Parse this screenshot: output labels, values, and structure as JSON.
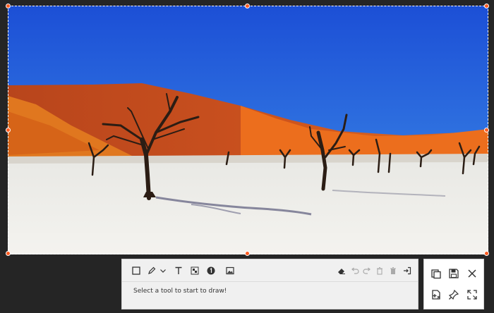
{
  "capture": {
    "image_description_icon": "desert-dead-trees-photo",
    "accent_color": "#ff5a1f"
  },
  "toolbar": {
    "tools": [
      {
        "name": "rectangle-tool",
        "icon": "square-icon"
      },
      {
        "name": "pen-tool",
        "icon": "pen-icon"
      },
      {
        "name": "pen-options-dropdown",
        "icon": "chevron-down-icon"
      },
      {
        "name": "text-tool",
        "icon": "text-icon"
      },
      {
        "name": "mosaic-tool",
        "icon": "mosaic-icon"
      },
      {
        "name": "step-number-tool",
        "icon": "numbered-circle-icon"
      },
      {
        "name": "image-tool",
        "icon": "image-icon"
      }
    ],
    "actions": [
      {
        "name": "eraser-button",
        "icon": "eraser-icon"
      },
      {
        "name": "undo-button",
        "icon": "undo-icon"
      },
      {
        "name": "redo-button",
        "icon": "redo-icon"
      },
      {
        "name": "delete-button",
        "icon": "trash-icon"
      },
      {
        "name": "clear-all-button",
        "icon": "trash-all-icon"
      },
      {
        "name": "exit-button",
        "icon": "exit-icon"
      }
    ],
    "hint": "Select a tool to start to draw!"
  },
  "side_panel": {
    "buttons": [
      {
        "name": "copy-button",
        "icon": "copy-icon"
      },
      {
        "name": "save-button",
        "icon": "save-icon"
      },
      {
        "name": "close-button",
        "icon": "close-icon"
      },
      {
        "name": "add-to-clipboard-button",
        "icon": "clipboard-add-icon"
      },
      {
        "name": "pin-button",
        "icon": "pin-icon"
      },
      {
        "name": "fullscreen-button",
        "icon": "expand-icon"
      }
    ]
  }
}
